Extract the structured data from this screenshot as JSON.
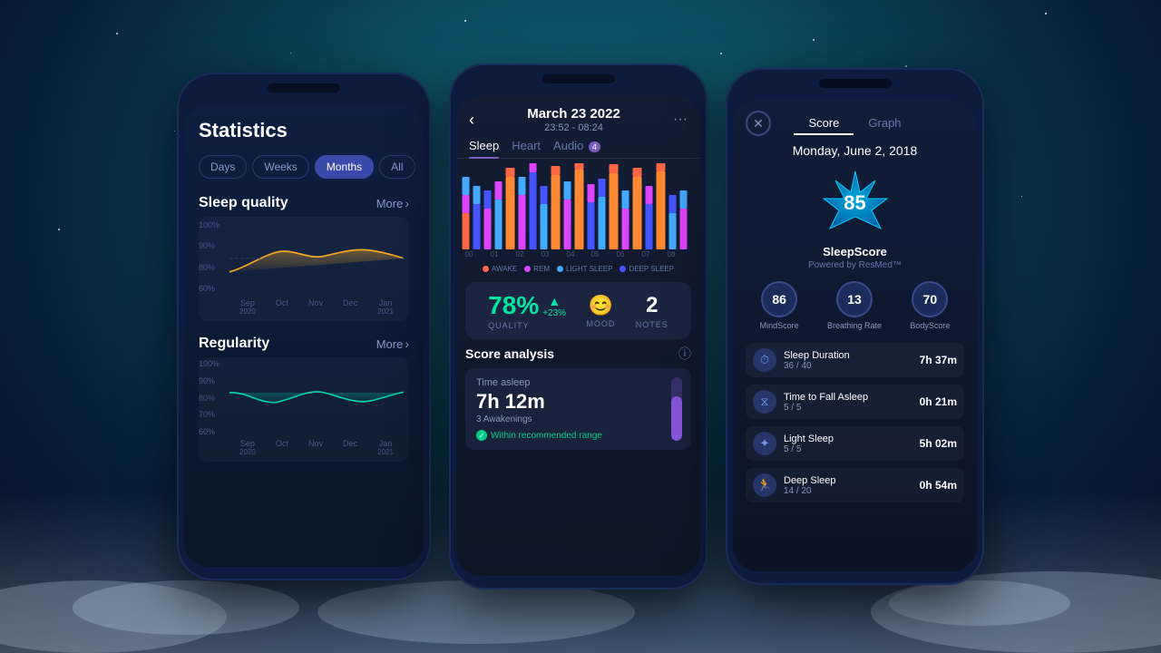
{
  "background": {
    "gradient_start": "#0a4a5e",
    "gradient_end": "#030d1f"
  },
  "phone1": {
    "title": "Statistics",
    "filters": [
      "Days",
      "Weeks",
      "Months",
      "All"
    ],
    "active_filter": "Months",
    "sleep_quality": {
      "section_title": "Sleep quality",
      "more_label": "More",
      "y_labels": [
        "100%",
        "90%",
        "80%",
        "60%"
      ],
      "x_labels": [
        {
          "month": "Sep",
          "year": "2020"
        },
        {
          "month": "Oct"
        },
        {
          "month": "Nov"
        },
        {
          "month": "Dec"
        },
        {
          "month": "Jan",
          "year": "2021"
        }
      ]
    },
    "regularity": {
      "section_title": "Regularity",
      "more_label": "More",
      "y_labels": [
        "100%",
        "90%",
        "80%",
        "70%",
        "60%"
      ],
      "x_labels": [
        {
          "month": "Sep",
          "year": "2020"
        },
        {
          "month": "Oct"
        },
        {
          "month": "Nov"
        },
        {
          "month": "Dec"
        },
        {
          "month": "Jan",
          "year": "2021"
        }
      ]
    }
  },
  "phone2": {
    "date": "March 23 2022",
    "time_range": "23:52 - 08:24",
    "tabs": [
      "Sleep",
      "Heart",
      "Audio"
    ],
    "active_tab": "Sleep",
    "audio_badge": "4",
    "chart_labels": [
      "00",
      "01",
      "02",
      "03",
      "04",
      "05",
      "06",
      "07",
      "08"
    ],
    "legend": [
      {
        "label": "AWAKE",
        "color": "#ff6644"
      },
      {
        "label": "REM",
        "color": "#dd44ff"
      },
      {
        "label": "LIGHT SLEEP",
        "color": "#44aaff"
      },
      {
        "label": "DEEP SLEEP",
        "color": "#4455ff"
      }
    ],
    "quality": {
      "percentage": "78%",
      "change": "+23%",
      "label": "QUALITY",
      "mood_icon": "😊",
      "mood_label": "MOOD",
      "notes_count": "2",
      "notes_label": "NOTES"
    },
    "score_analysis": {
      "title": "Score analysis",
      "time_asleep_label": "Time asleep",
      "time_asleep_value": "7h 12m",
      "awakenings": "3 Awakenings",
      "recommended": "Within recommended range",
      "bar_fill_pct": 70
    }
  },
  "phone3": {
    "close_icon": "✕",
    "tabs": [
      "Score",
      "Graph"
    ],
    "active_tab": "Score",
    "date": "Monday, June 2, 2018",
    "score_number": "85",
    "score_name": "SleepScore",
    "score_powered": "Powered by ResMed™",
    "sub_scores": [
      {
        "label": "MindScore",
        "value": "86"
      },
      {
        "label": "Breathing Rate",
        "value": "13"
      },
      {
        "label": "BodyScore",
        "value": "70"
      }
    ],
    "metrics": [
      {
        "icon": "⏱",
        "name": "Sleep Duration",
        "score": "36 / 40",
        "value": "7h 37m"
      },
      {
        "icon": "⧗",
        "name": "Time to Fall Asleep",
        "score": "5 / 5",
        "value": "0h 21m"
      },
      {
        "icon": "✦",
        "name": "Light Sleep",
        "score": "5 / 5",
        "value": "5h 02m"
      },
      {
        "icon": "🏃",
        "name": "Deep Sleep",
        "score": "14 / 20",
        "value": "0h 54m"
      }
    ]
  }
}
